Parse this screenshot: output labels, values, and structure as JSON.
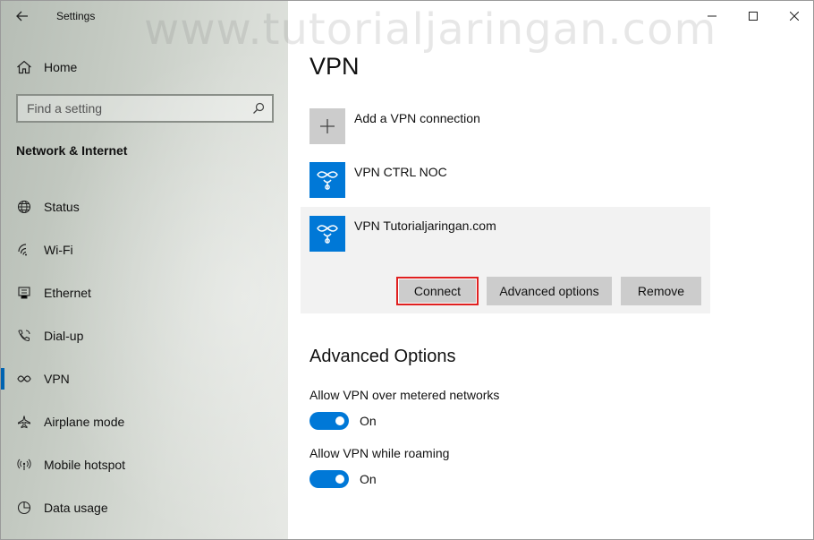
{
  "app": {
    "title": "Settings"
  },
  "watermark": "www.tutorialjaringan.com",
  "sidebar": {
    "home_label": "Home",
    "search_placeholder": "Find a setting",
    "section_title": "Network & Internet",
    "items": [
      {
        "label": "Status",
        "icon": "globe-icon"
      },
      {
        "label": "Wi-Fi",
        "icon": "wifi-icon"
      },
      {
        "label": "Ethernet",
        "icon": "ethernet-icon"
      },
      {
        "label": "Dial-up",
        "icon": "dialup-icon"
      },
      {
        "label": "VPN",
        "icon": "vpn-icon",
        "active": true
      },
      {
        "label": "Airplane mode",
        "icon": "airplane-icon"
      },
      {
        "label": "Mobile hotspot",
        "icon": "hotspot-icon"
      },
      {
        "label": "Data usage",
        "icon": "data-usage-icon"
      }
    ]
  },
  "main": {
    "title": "VPN",
    "add_label": "Add a VPN connection",
    "connections": [
      {
        "name": "VPN CTRL NOC"
      },
      {
        "name": "VPN Tutorialjaringan.com",
        "selected": true
      }
    ],
    "buttons": {
      "connect": "Connect",
      "advanced": "Advanced options",
      "remove": "Remove"
    },
    "advanced_title": "Advanced Options",
    "options": [
      {
        "label": "Allow VPN over metered networks",
        "state": "On"
      },
      {
        "label": "Allow VPN while roaming",
        "state": "On"
      }
    ]
  },
  "colors": {
    "accent": "#0078d7",
    "highlight": "#e02020"
  }
}
